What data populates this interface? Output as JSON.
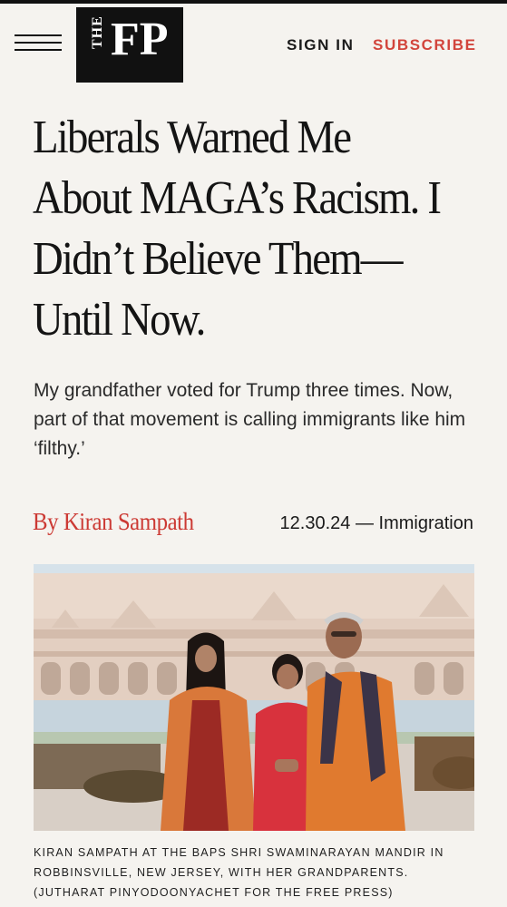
{
  "header": {
    "logo_the": "THE",
    "logo_fp": "FP",
    "sign_in": "SIGN IN",
    "subscribe": "SUBSCRIBE"
  },
  "article": {
    "headline": "Liberals Warned Me About MAGA’s Racism. I Didn’t Believe Them—Until Now.",
    "dek": "My grandfather voted for Trump three times. Now, part of that movement is calling immigrants like him ‘filthy.’",
    "byline": "By Kiran Sampath",
    "date": "12.30.24",
    "separator": "—",
    "category": "Immigration",
    "caption": "Kiran Sampath at the BAPS Shri Swaminarayan Mandir in Robbinsville, New Jersey, with her grandparents. (Jutharat Pinyodoonyachet for The Free Press)"
  },
  "colors": {
    "background": "#f5f3ef",
    "accent": "#d2453c",
    "text": "#1a1a1a",
    "logo_bg": "#111111"
  },
  "icons": {
    "menu": "hamburger-menu-icon"
  }
}
